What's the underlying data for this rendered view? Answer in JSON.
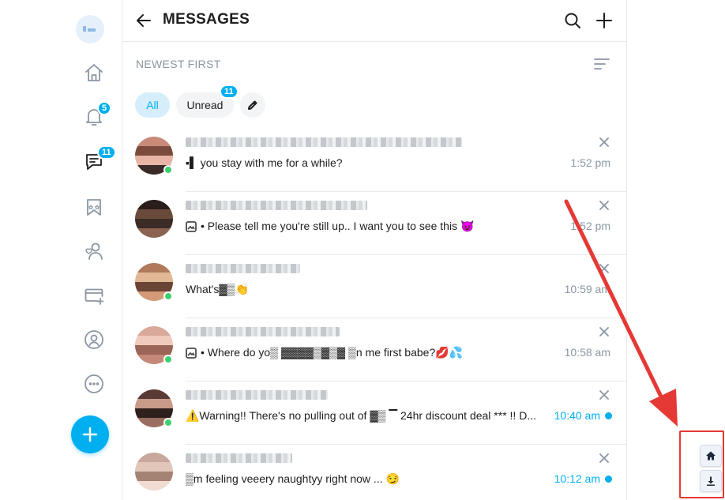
{
  "sidebar": {
    "items": [
      {
        "name": "home",
        "badge": ""
      },
      {
        "name": "notifications",
        "badge": "5"
      },
      {
        "name": "messages",
        "badge": "11"
      },
      {
        "name": "collections",
        "badge": ""
      },
      {
        "name": "subscriptions",
        "badge": ""
      },
      {
        "name": "add-card",
        "badge": ""
      },
      {
        "name": "profile",
        "badge": ""
      },
      {
        "name": "more",
        "badge": ""
      }
    ]
  },
  "header": {
    "title": "MESSAGES"
  },
  "sort": {
    "label": "NEWEST FIRST"
  },
  "filters": {
    "all_label": "All",
    "unread_label": "Unread",
    "unread_count": "11"
  },
  "chats": [
    {
      "message": "▪▌ you stay with me for a while?",
      "has_icon": false,
      "time": "1:52 pm",
      "unread": false,
      "online": true
    },
    {
      "message": "• Please tell me you're still up.. I want you to see this 😈",
      "has_icon": true,
      "time": "1:52 pm",
      "unread": false,
      "online": false
    },
    {
      "message": "What's▓▒👏",
      "has_icon": false,
      "time": "10:59 am",
      "unread": false,
      "online": true
    },
    {
      "message": "• Where do yo▒ ▓▓▓▓▒▓▒▓ ▒n me first babe?💋💦",
      "has_icon": true,
      "time": "10:58 am",
      "unread": false,
      "online": true
    },
    {
      "message": "⚠️Warning!! There's no pulling out of ▓▒ ▔ 24hr discount deal *** !! D...",
      "has_icon": false,
      "time": "10:40 am",
      "unread": true,
      "online": true
    },
    {
      "message": "▒m feeling veeery naughtyy right now ... 😏",
      "has_icon": false,
      "time": "10:12 am",
      "unread": true,
      "online": false
    }
  ],
  "colors": {
    "accent": "#00aff0",
    "online": "#3ecf6e",
    "annotation": "#e53935"
  },
  "floating_buttons": [
    "home-icon",
    "download-icon"
  ]
}
